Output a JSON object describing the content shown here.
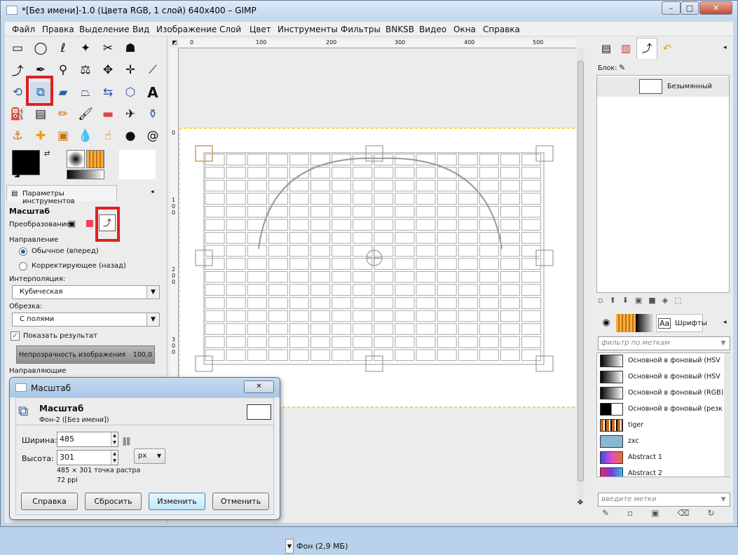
{
  "window": {
    "title": "*[Без имени]-1.0 (Цвета RGB, 1 слой) 640x400 – GIMP",
    "minimize": "–",
    "maximize": "□",
    "close": "✕"
  },
  "menu": [
    "Файл",
    "Правка",
    "Выделение",
    "Вид",
    "Изображение",
    "Слой",
    "Цвет",
    "Инструменты",
    "Фильтры",
    "BNKSB",
    "Видео",
    "Окна",
    "Справка"
  ],
  "tool_options": {
    "tab_label": "Параметры инструментов",
    "title": "Масштаб",
    "transform_label": "Преобразование:",
    "direction_label": "Направление",
    "direction_normal": "Обычное (вперед)",
    "direction_corrective": "Корректирующее (назад)",
    "interpolation_label": "Интерполяция:",
    "interpolation_value": "Кубическая",
    "clipping_label": "Обрезка:",
    "clipping_value": "С полями",
    "show_result": "Показать результат",
    "opacity_label": "Непрозрачность изображения",
    "opacity_value": "100,0",
    "guides_label": "Направляющие"
  },
  "ruler": {
    "h": [
      "0",
      "100",
      "200",
      "300",
      "400",
      "500"
    ],
    "v": [
      "0",
      "1\n0\n0",
      "2\n0\n0",
      "3\n0\n0"
    ]
  },
  "status": {
    "layer": "Фон (2,9 МБ)"
  },
  "brushes": {
    "label": "Блок:",
    "item": "Безымянный"
  },
  "gradients": {
    "tab_fonts": "Шрифты",
    "filter_placeholder": "фильтр по меткам",
    "tags_placeholder": "введите метки",
    "items": [
      {
        "name": "Основной в фоновый  (HSV",
        "color": "#111111"
      },
      {
        "name": "Основной в фоновый  (HSV",
        "color": "#111111"
      },
      {
        "name": "Основной в фоновый (RGB)",
        "color": "#111111"
      },
      {
        "name": "Основной в фоновый (резк",
        "color": "#000000"
      },
      {
        "name": "tiger",
        "color": "#c66a1c"
      },
      {
        "name": "zxc",
        "color": "#8ab8d0"
      },
      {
        "name": "Abstract 1",
        "color": "#3a4bd8"
      },
      {
        "name": "Abstract 2",
        "color": "#e0246a"
      }
    ]
  },
  "scale_dialog": {
    "title": "Масштаб",
    "heading": "Масштаб",
    "subheading": "Фон-2 ([Без имени])",
    "width_label": "Ширина:",
    "width_value": "485",
    "height_label": "Высота:",
    "height_value": "301",
    "unit": "px",
    "info_size": "485 × 301 точка растра",
    "info_res": "72 ppi",
    "btn_help": "Справка",
    "btn_reset": "Сбросить",
    "btn_change": "Изменить",
    "btn_cancel": "Отменить"
  },
  "colors": {
    "accent_red": "#e01f1f",
    "guide": "#f0d000"
  }
}
